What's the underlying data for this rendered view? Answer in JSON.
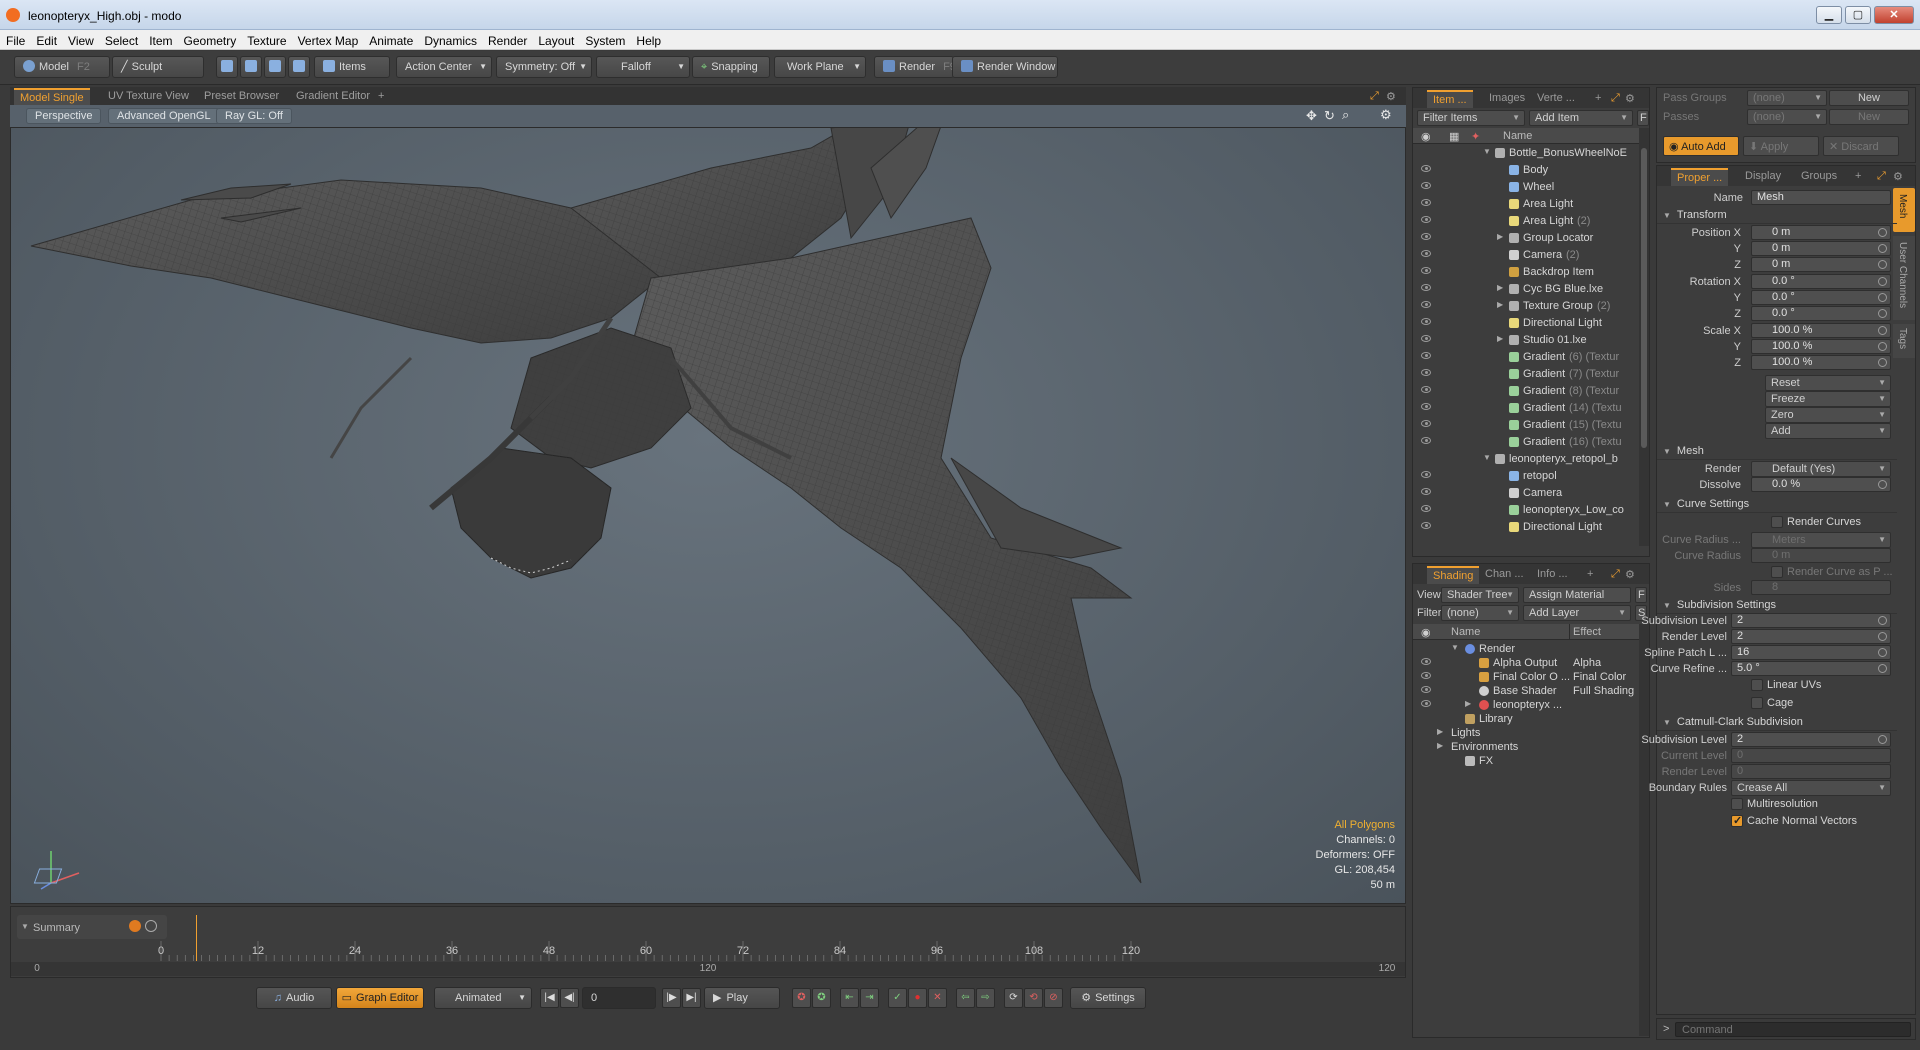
{
  "window": {
    "title": "leonopteryx_High.obj - modo"
  },
  "menu": [
    "File",
    "Edit",
    "View",
    "Select",
    "Item",
    "Geometry",
    "Texture",
    "Vertex Map",
    "Animate",
    "Dynamics",
    "Render",
    "Layout",
    "System",
    "Help"
  ],
  "toolbar": {
    "model": "Model",
    "model_key": "F2",
    "sculpt": "Sculpt",
    "items": "Items",
    "action_center": "Action Center",
    "symmetry": "Symmetry: Off",
    "falloff": "Falloff",
    "snapping": "Snapping",
    "work_plane": "Work Plane",
    "render": "Render",
    "render_key": "F9",
    "render_window": "Render Window"
  },
  "viewport": {
    "tabs": [
      "Model Single",
      "UV Texture View",
      "Preset Browser",
      "Gradient Editor",
      "+"
    ],
    "perspective": "Perspective",
    "opengl": "Advanced OpenGL",
    "raygl": "Ray GL: Off",
    "info": {
      "mode": "All Polygons",
      "channels": "Channels: 0",
      "deformers": "Deformers: OFF",
      "gl": "GL: 208,454",
      "scale": "50 m"
    }
  },
  "timeline": {
    "summary": "Summary",
    "ticks": [
      "0",
      "12",
      "24",
      "36",
      "48",
      "60",
      "72",
      "84",
      "96",
      "108",
      "120"
    ],
    "lower_ticks": [
      "0",
      "120",
      "120"
    ]
  },
  "transport": {
    "audio": "Audio",
    "graph_editor": "Graph Editor",
    "animated": "Animated",
    "frame": "0",
    "play": "Play",
    "settings": "Settings"
  },
  "items_panel": {
    "tabs": [
      "Item ...",
      "Images",
      "Verte ..."
    ],
    "filter": "Filter Items",
    "add": "Add Item",
    "f": "F",
    "name_col": "Name",
    "rows": [
      {
        "label": "Bottle_BonusWheelNoE",
        "extra": "",
        "type": "group",
        "indent": 0,
        "toggle": "▼"
      },
      {
        "label": "Body",
        "extra": "",
        "type": "mesh",
        "indent": 1,
        "toggle": ""
      },
      {
        "label": "Wheel",
        "extra": "",
        "type": "mesh",
        "indent": 1,
        "toggle": ""
      },
      {
        "label": "Area Light",
        "extra": "",
        "type": "light",
        "indent": 1,
        "toggle": ""
      },
      {
        "label": "Area Light",
        "extra": "(2)",
        "type": "light",
        "indent": 1,
        "toggle": ""
      },
      {
        "label": "Group Locator",
        "extra": "",
        "type": "locator",
        "indent": 1,
        "toggle": "▶"
      },
      {
        "label": "Camera",
        "extra": "(2)",
        "type": "camera",
        "indent": 1,
        "toggle": ""
      },
      {
        "label": "Backdrop Item",
        "extra": "",
        "type": "backdrop",
        "indent": 1,
        "toggle": ""
      },
      {
        "label": "Cyc BG Blue.lxe",
        "extra": "",
        "type": "locator",
        "indent": 1,
        "toggle": "▶"
      },
      {
        "label": "Texture Group",
        "extra": "(2)",
        "type": "locator",
        "indent": 1,
        "toggle": "▶"
      },
      {
        "label": "Directional Light",
        "extra": "",
        "type": "dirlight",
        "indent": 1,
        "toggle": ""
      },
      {
        "label": "Studio 01.lxe",
        "extra": "",
        "type": "locator",
        "indent": 1,
        "toggle": "▶"
      },
      {
        "label": "Gradient",
        "extra": "(6) (Textur",
        "type": "gradient",
        "indent": 1,
        "toggle": ""
      },
      {
        "label": "Gradient",
        "extra": "(7) (Textur",
        "type": "gradient",
        "indent": 1,
        "toggle": ""
      },
      {
        "label": "Gradient",
        "extra": "(8) (Textur",
        "type": "gradient",
        "indent": 1,
        "toggle": ""
      },
      {
        "label": "Gradient",
        "extra": "(14) (Textu",
        "type": "gradient",
        "indent": 1,
        "toggle": ""
      },
      {
        "label": "Gradient",
        "extra": "(15) (Textu",
        "type": "gradient",
        "indent": 1,
        "toggle": ""
      },
      {
        "label": "Gradient",
        "extra": "(16) (Textu",
        "type": "gradient",
        "indent": 1,
        "toggle": ""
      },
      {
        "label": "leonopteryx_retopol_b",
        "extra": "",
        "type": "group",
        "indent": 0,
        "toggle": "▼"
      },
      {
        "label": "retopol",
        "extra": "",
        "type": "mesh",
        "indent": 1,
        "toggle": ""
      },
      {
        "label": "Camera",
        "extra": "",
        "type": "camera",
        "indent": 1,
        "toggle": ""
      },
      {
        "label": "leonopteryx_Low_co",
        "extra": "",
        "type": "gradient",
        "indent": 1,
        "toggle": ""
      },
      {
        "label": "Directional Light",
        "extra": "",
        "type": "dirlight",
        "indent": 1,
        "toggle": ""
      }
    ]
  },
  "shading_panel": {
    "tabs": [
      "Shading",
      "Chan ...",
      "Info ..."
    ],
    "view_label": "View",
    "view_value": "Shader Tree",
    "assign": "Assign Material",
    "filter_label": "Filter",
    "filter_value": "(none)",
    "add_layer": "Add Layer",
    "f": "F",
    "s": "S",
    "name_col": "Name",
    "effect_col": "Effect",
    "rows": [
      {
        "label": "Render",
        "effect": "",
        "indent": 0,
        "type": "render",
        "toggle": "▼",
        "eye": false
      },
      {
        "label": "Alpha Output",
        "effect": "Alpha",
        "indent": 1,
        "type": "output",
        "toggle": "",
        "eye": true
      },
      {
        "label": "Final Color O ...",
        "effect": "Final Color",
        "indent": 1,
        "type": "output",
        "toggle": "",
        "eye": true
      },
      {
        "label": "Base Shader",
        "effect": "Full Shading",
        "indent": 1,
        "type": "shader",
        "toggle": "",
        "eye": true
      },
      {
        "label": "leonopteryx ...",
        "effect": "",
        "indent": 1,
        "type": "material",
        "toggle": "▶",
        "eye": true
      },
      {
        "label": "Library",
        "effect": "",
        "indent": 0,
        "type": "folder",
        "toggle": "",
        "eye": false
      },
      {
        "label": "Lights",
        "effect": "",
        "indent": -1,
        "type": "none",
        "toggle": "▶",
        "eye": false
      },
      {
        "label": "Environments",
        "effect": "",
        "indent": -1,
        "type": "none",
        "toggle": "▶",
        "eye": false
      },
      {
        "label": "FX",
        "effect": "",
        "indent": 0,
        "type": "fx",
        "toggle": "",
        "eye": false
      }
    ]
  },
  "passes": {
    "groups_label": "Pass Groups",
    "groups_value": "(none)",
    "new": "New",
    "passes_label": "Passes",
    "passes_value": "(none)",
    "new2": "New",
    "auto_add": "Auto Add",
    "apply": "Apply",
    "discard": "Discard"
  },
  "properties": {
    "tabs": [
      "Proper ...",
      "Display",
      "Groups"
    ],
    "side_tabs": [
      "Mesh",
      "User Channels",
      "Tags"
    ],
    "name_label": "Name",
    "name_value": "Mesh",
    "transform": "Transform",
    "position_x_label": "Position X",
    "position_x": "0 m",
    "position_y": "0 m",
    "position_z": "0 m",
    "rotation_x_label": "Rotation X",
    "rotation_x": "0.0 °",
    "rotation_y": "0.0 °",
    "rotation_z": "0.0 °",
    "scale_x_label": "Scale X",
    "scale_x": "100.0 %",
    "scale_y": "100.0 %",
    "scale_z": "100.0 %",
    "y": "Y",
    "z": "Z",
    "reset": "Reset",
    "freeze": "Freeze",
    "zero": "Zero",
    "add": "Add",
    "mesh": "Mesh",
    "render_label": "Render",
    "render_value": "Default (Yes)",
    "dissolve_label": "Dissolve",
    "dissolve_value": "0.0 %",
    "curve_settings": "Curve Settings",
    "render_curves": "Render Curves",
    "curve_radius_label": "Curve Radius ...",
    "curve_radius_unit": "Meters",
    "curve_radius2_label": "Curve Radius",
    "curve_radius2": "0 m",
    "render_curve_as": "Render Curve as P ...",
    "sides_label": "Sides",
    "sides": "8",
    "subdivision_settings": "Subdivision Settings",
    "subdiv_level_label": "Subdivision Level",
    "subdiv_level": "2",
    "render_level_label": "Render Level",
    "render_level": "2",
    "spline_patch_label": "Spline Patch L ...",
    "spline_patch": "16",
    "curve_refine_label": "Curve Refine ...",
    "curve_refine": "5.0 °",
    "linear_uvs": "Linear UVs",
    "cage": "Cage",
    "catmull": "Catmull-Clark Subdivision",
    "cc_subdiv_label": "Subdivision Level",
    "cc_subdiv": "2",
    "current_level_label": "Current Level",
    "current_level": "0",
    "cc_render_level_label": "Render Level",
    "cc_render_level": "0",
    "boundary_label": "Boundary Rules",
    "boundary_value": "Crease All",
    "multires": "Multiresolution",
    "cache_normals": "Cache Normal Vectors"
  },
  "command": {
    "placeholder": "Command",
    "prompt": ">"
  },
  "colors": {
    "accent": "#f0a030",
    "viewport_bg": "#5a646d",
    "mesh": "#4a4a4a"
  }
}
